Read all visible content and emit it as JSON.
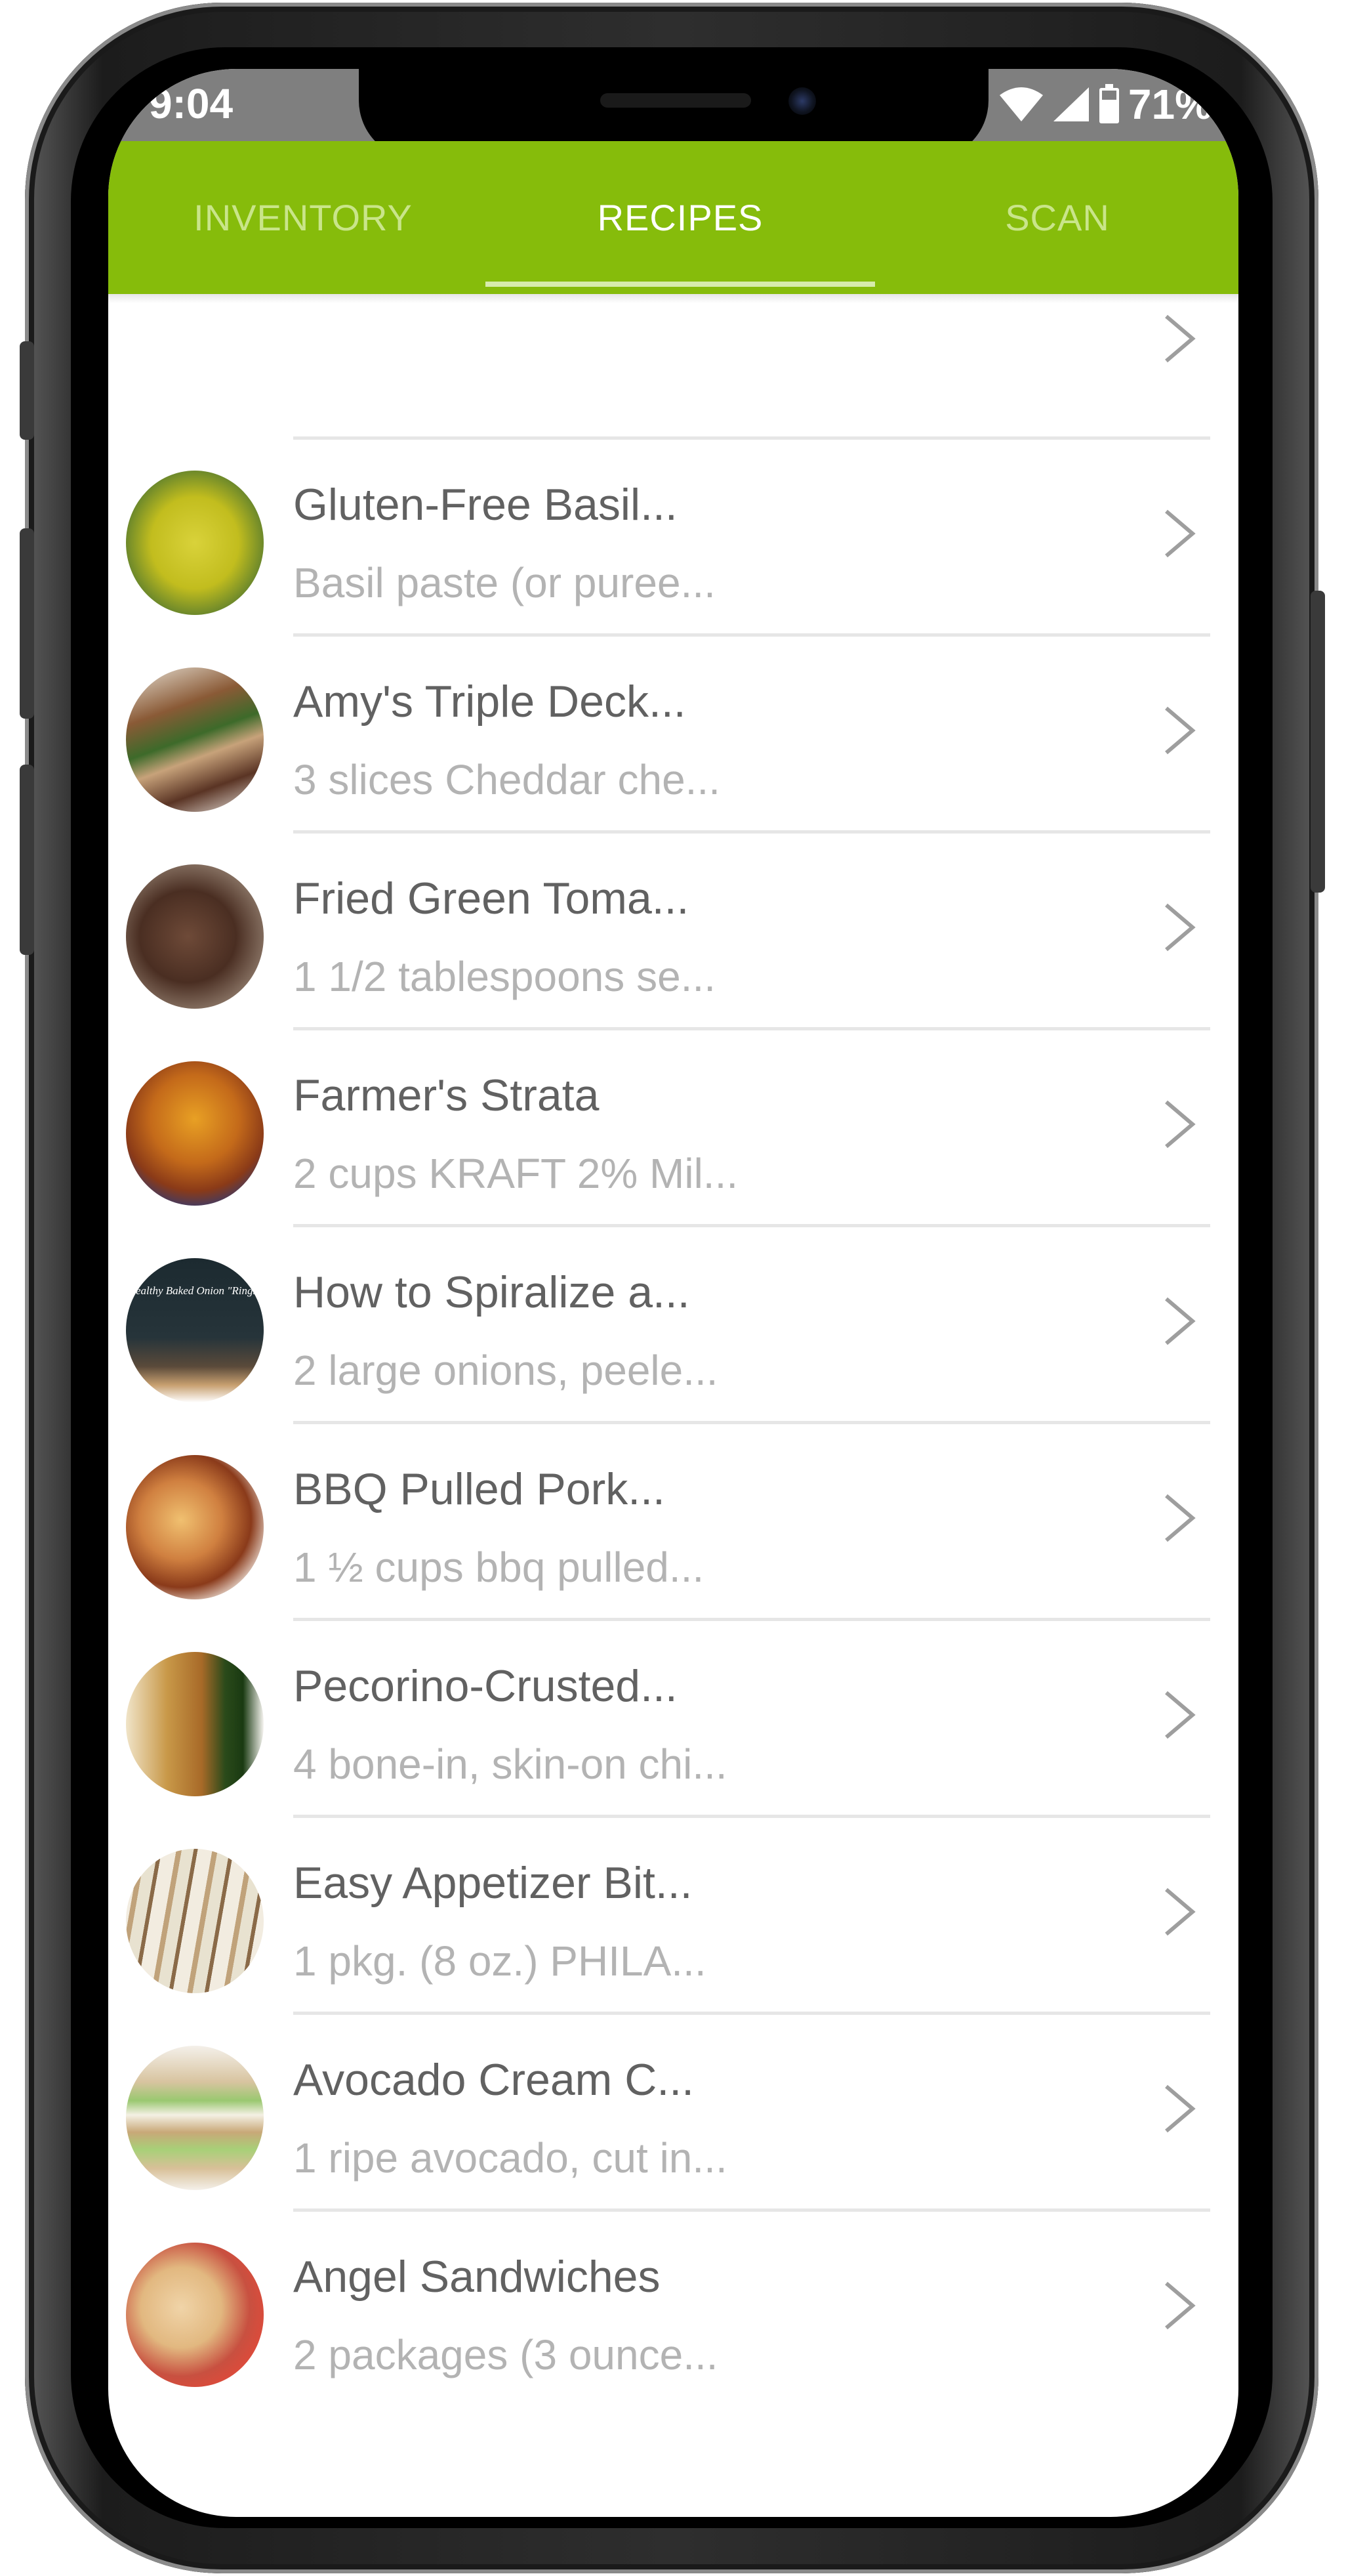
{
  "status_bar": {
    "time": "9:04",
    "battery": "71%"
  },
  "tabs": [
    {
      "label": "INVENTORY",
      "active": false
    },
    {
      "label": "RECIPES",
      "active": true
    },
    {
      "label": "SCAN",
      "active": false
    }
  ],
  "recipes": [
    {
      "title": "Gluten-Free Basil...",
      "subtitle": "Basil paste (or puree..."
    },
    {
      "title": "Amy's Triple Deck...",
      "subtitle": "3 slices Cheddar che..."
    },
    {
      "title": "Fried Green Toma...",
      "subtitle": "1 1/2 tablespoons se..."
    },
    {
      "title": "Farmer's Strata",
      "subtitle": "2 cups KRAFT 2% Mil..."
    },
    {
      "title": "How to Spiralize a...",
      "subtitle": "2 large onions, peele..."
    },
    {
      "title": "BBQ Pulled Pork...",
      "subtitle": "1 ½ cups bbq pulled..."
    },
    {
      "title": "Pecorino-Crusted...",
      "subtitle": "4 bone-in, skin-on chi..."
    },
    {
      "title": "Easy Appetizer Bit...",
      "subtitle": "1 pkg. (8 oz.) PHILA..."
    },
    {
      "title": "Avocado Cream C...",
      "subtitle": "1 ripe avocado, cut in..."
    },
    {
      "title": "Angel Sandwiches",
      "subtitle": "2 packages (3 ounce..."
    }
  ],
  "thumbnail_overlay_text": "Healthy Baked Onion \"Rings\"",
  "colors": {
    "accent_green": "#86bc0b",
    "title_text": "#616161",
    "subtitle_text": "#b3b3b3"
  }
}
